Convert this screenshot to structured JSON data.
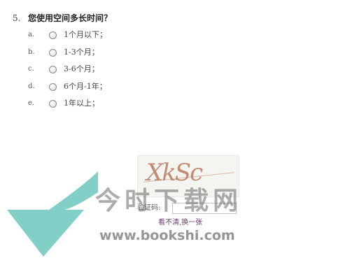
{
  "question": {
    "number": "5.",
    "title": "您使用空间多长时间？",
    "options": [
      {
        "letter": "a.",
        "label": "1个月以下；"
      },
      {
        "letter": "b.",
        "label": "1-3个月；"
      },
      {
        "letter": "c.",
        "label": "3-6个月；"
      },
      {
        "letter": "d.",
        "label": "6个月-1年；"
      },
      {
        "letter": "e.",
        "label": "1年以上；"
      }
    ]
  },
  "captcha": {
    "image_text": "XkSc",
    "label": "验证码:",
    "input_value": "",
    "refresh_link": "看不清,换一张"
  },
  "watermark": {
    "text": "今时下载网",
    "url": "www.bookshi.com",
    "arrow_color": "#6cc7bd"
  }
}
